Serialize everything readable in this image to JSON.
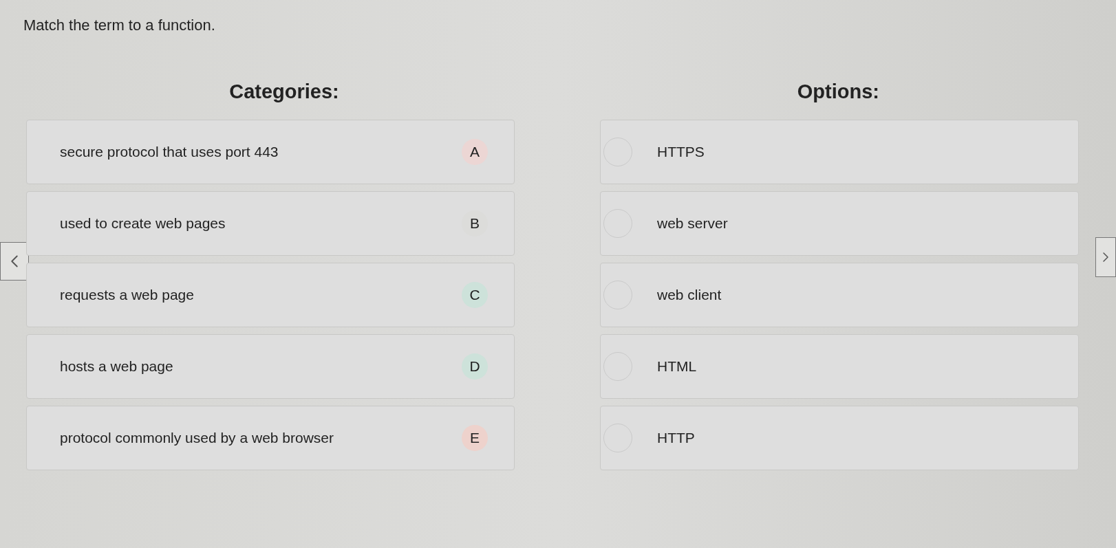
{
  "instruction": "Match the term to a function.",
  "categories_heading": "Categories:",
  "options_heading": "Options:",
  "categories": [
    {
      "text": "secure protocol that uses port 443",
      "letter": "A",
      "color": "#ecd6d4"
    },
    {
      "text": "used to create web pages",
      "letter": "B",
      "color": "#dcdcda"
    },
    {
      "text": "requests a web page",
      "letter": "C",
      "color": "#cde2da"
    },
    {
      "text": "hosts a web page",
      "letter": "D",
      "color": "#cde2da"
    },
    {
      "text": "protocol commonly used by a web browser",
      "letter": "E",
      "color": "#eed2cc"
    }
  ],
  "options": [
    {
      "text": "HTTPS"
    },
    {
      "text": "web server"
    },
    {
      "text": "web client"
    },
    {
      "text": "HTML"
    },
    {
      "text": "HTTP"
    }
  ]
}
